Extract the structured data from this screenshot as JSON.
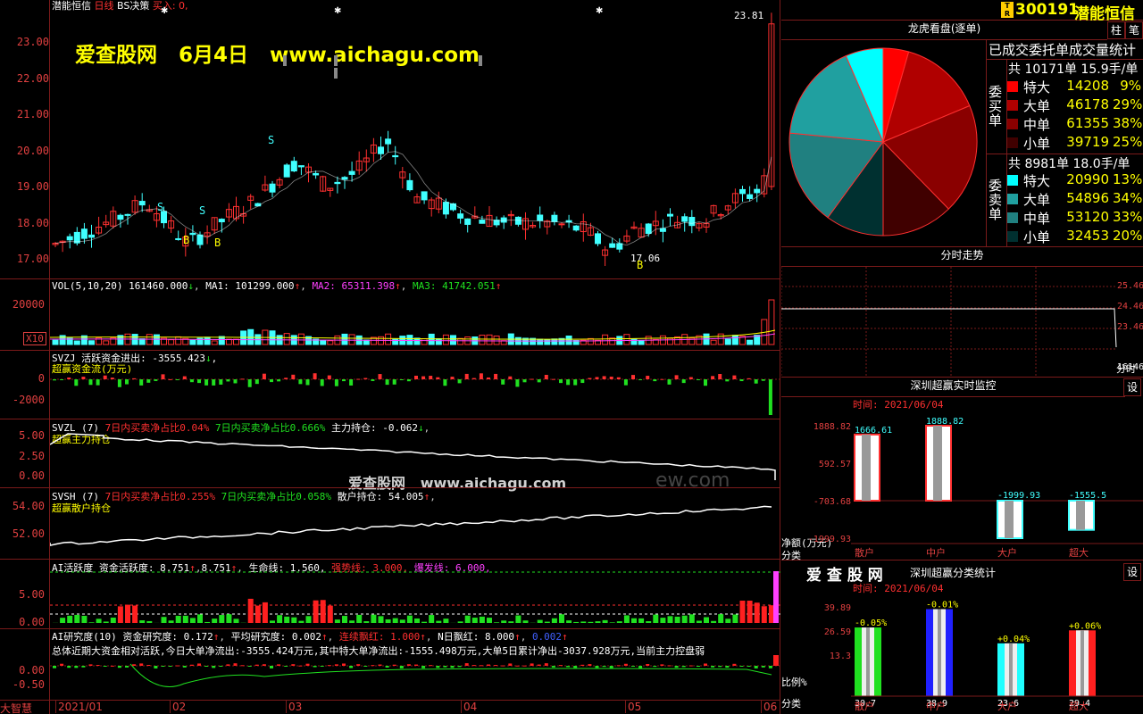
{
  "header": {
    "stock_name": "潜能恒信",
    "period": "日线",
    "strategy": "BS决策",
    "signal": "买入: 0,",
    "code": "300191",
    "badge": "T R",
    "watermark_top": "爱查股网   6月4日   www.aichagu.com",
    "watermark_mid": "爱查股网   www.aichagu.com",
    "watermark_mid2": "ew.com",
    "high_price": "23.81",
    "low_price": "17.06"
  },
  "price_axis": [
    "23.00",
    "22.00",
    "21.00",
    "20.00",
    "19.00",
    "18.00",
    "17.00"
  ],
  "vol_panel": {
    "title": "VOL(5,10,20)",
    "vol": "161460.000",
    "ma1": "MA1: 101299.000",
    "ma2": "MA2: 65311.398",
    "ma3": "MA3: 41742.051",
    "axis_top": "20000",
    "axis_unit": "X10"
  },
  "svzj_panel": {
    "title": "SVZJ",
    "line1": "活跃资金进出: -3555.423",
    "line2": "超赢资金流(万元)",
    "axis": [
      "0",
      "-2000"
    ]
  },
  "svzl_panel": {
    "title": "SVZL (7)",
    "buy_ratio": "7日内买卖净占比0.04%",
    "sell_ratio": "7日内买卖净占比0.666%",
    "hold": "主力持仓: -0.062",
    "label": "超赢主力持仓",
    "axis": [
      "5.00",
      "2.50",
      "0.00"
    ]
  },
  "svsh_panel": {
    "title": "SVSH (7)",
    "buy_ratio": "7日内买卖净占比0.255%",
    "sell_ratio": "7日内买卖净占比0.058%",
    "hold": "散户持仓: 54.005",
    "label": "超赢散户持仓",
    "axis": [
      "54.00",
      "52.00"
    ]
  },
  "ai_panel": {
    "title": "AI活跃度",
    "line": "资金活跃度: 8.751",
    "line_b": "8.751",
    "life": "生命线: 1.560,",
    "strong": "强势线: 3.000,",
    "burst": "爆发线: 6.000,",
    "axis": [
      "5.00",
      "0.00"
    ]
  },
  "research_panel": {
    "title": "AI研究度(10)",
    "line": "资金研究度: 0.172",
    "avg": "平均研究度: 0.002",
    "cont": "连续飘红: 1.000",
    "n": "N日飘红: 8.000",
    "extra": "0.002",
    "summary": "总体近期大资金相对活跃,今日大单净流出:-3555.424万元,其中特大单净流出:-1555.498万元,大单5日累计净出-3037.928万元,当前主力控盘弱",
    "axis": [
      "0.00",
      "-0.50"
    ]
  },
  "date_axis": [
    "2021/01",
    "02",
    "03",
    "04",
    "05",
    "06"
  ],
  "brand": "大智慧",
  "right": {
    "tab1": "柱",
    "tab2": "笔",
    "pie_title": "龙虎看盘(逐单)",
    "stats_title": "已成交委托单成交量统计",
    "buy_total": "共 10171单 15.9手/单",
    "buy_side": "委买单",
    "sell_total": "共 8981单 18.0手/单",
    "sell_side": "委卖单",
    "buy_rows": [
      {
        "name": "特大",
        "value": "14208",
        "pct": "9%",
        "color": "#ff0000"
      },
      {
        "name": "大单",
        "value": "46178",
        "pct": "29%",
        "color": "#b00000"
      },
      {
        "name": "中单",
        "value": "61355",
        "pct": "38%",
        "color": "#8a0000"
      },
      {
        "name": "小单",
        "value": "39719",
        "pct": "25%",
        "color": "#400000"
      }
    ],
    "sell_rows": [
      {
        "name": "特大",
        "value": "20990",
        "pct": "13%",
        "color": "#00ffff"
      },
      {
        "name": "大单",
        "value": "54896",
        "pct": "34%",
        "color": "#20a0a0"
      },
      {
        "name": "中单",
        "value": "53120",
        "pct": "33%",
        "color": "#208080"
      },
      {
        "name": "小单",
        "value": "32453",
        "pct": "20%",
        "color": "#003030"
      }
    ],
    "intraday_title": "分时走势",
    "intraday_axis": [
      "25.46",
      "24.46",
      "23.46",
      "16146"
    ],
    "intraday_unit": "分时",
    "monitor_title": "深圳超赢实时监控",
    "monitor_set": "设",
    "monitor_time": "时间: 2021/06/04",
    "monitor_axis": [
      "1888.82",
      "592.57",
      "-703.68",
      "-1999.93"
    ],
    "monitor_unit": "净额(万元)",
    "monitor_cat_label": "分类",
    "monitor_bars": [
      {
        "name": "散户",
        "value": "1666.61"
      },
      {
        "name": "中户",
        "value": "1888.82"
      },
      {
        "name": "大户",
        "value": "-1999.93"
      },
      {
        "name": "超大",
        "value": "-1555.5"
      }
    ],
    "stats2_brand": "爱 查 股 网",
    "stats2_title": "深圳超赢分类统计",
    "stats2_set": "设",
    "stats2_time": "时间: 2021/06/04",
    "stats2_axis": [
      "39.89",
      "26.59",
      "13.3"
    ],
    "stats2_unit": "比例%",
    "stats2_cat_label": "分类",
    "stats2_bars": [
      {
        "name": "散户",
        "value": "30.7",
        "delta": "-0.05%",
        "color": "#20e020"
      },
      {
        "name": "中户",
        "value": "38.9",
        "delta": "-0.01%",
        "color": "#2020ff"
      },
      {
        "name": "大户",
        "value": "23.6",
        "delta": "+0.04%",
        "color": "#20ffff"
      },
      {
        "name": "超大",
        "value": "29.4",
        "delta": "+0.06%",
        "color": "#ff2020"
      }
    ]
  }
}
